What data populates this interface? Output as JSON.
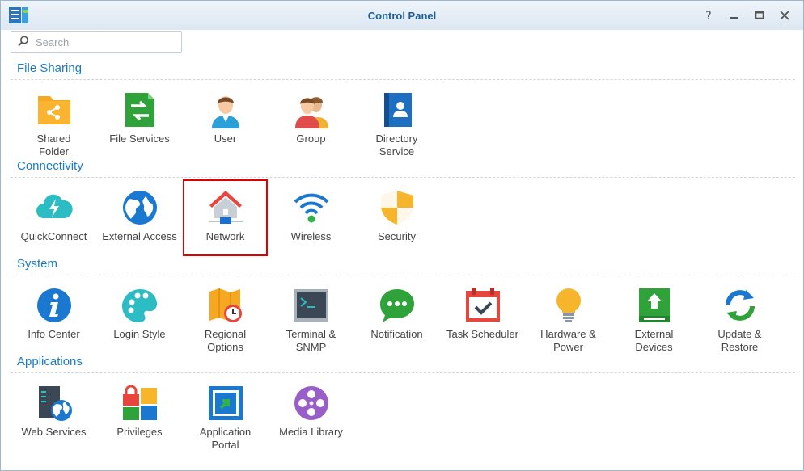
{
  "window": {
    "title": "Control Panel"
  },
  "search": {
    "placeholder": "Search"
  },
  "sections": [
    {
      "title": "File Sharing",
      "items": [
        {
          "label": "Shared\nFolder",
          "icon": "shared-folder-icon"
        },
        {
          "label": "File Services",
          "icon": "file-services-icon"
        },
        {
          "label": "User",
          "icon": "user-icon"
        },
        {
          "label": "Group",
          "icon": "group-icon"
        },
        {
          "label": "Directory\nService",
          "icon": "directory-service-icon"
        }
      ]
    },
    {
      "title": "Connectivity",
      "items": [
        {
          "label": "QuickConnect",
          "icon": "quickconnect-icon"
        },
        {
          "label": "External Access",
          "icon": "external-access-icon"
        },
        {
          "label": "Network",
          "icon": "network-icon",
          "selected": true
        },
        {
          "label": "Wireless",
          "icon": "wireless-icon"
        },
        {
          "label": "Security",
          "icon": "security-icon"
        }
      ]
    },
    {
      "title": "System",
      "items": [
        {
          "label": "Info Center",
          "icon": "info-center-icon"
        },
        {
          "label": "Login Style",
          "icon": "login-style-icon"
        },
        {
          "label": "Regional\nOptions",
          "icon": "regional-options-icon"
        },
        {
          "label": "Terminal &\nSNMP",
          "icon": "terminal-snmp-icon"
        },
        {
          "label": "Notification",
          "icon": "notification-icon"
        },
        {
          "label": "Task Scheduler",
          "icon": "task-scheduler-icon"
        },
        {
          "label": "Hardware &\nPower",
          "icon": "hardware-power-icon"
        },
        {
          "label": "External\nDevices",
          "icon": "external-devices-icon"
        },
        {
          "label": "Update &\nRestore",
          "icon": "update-restore-icon"
        }
      ]
    },
    {
      "title": "Applications",
      "items": [
        {
          "label": "Web Services",
          "icon": "web-services-icon"
        },
        {
          "label": "Privileges",
          "icon": "privileges-icon"
        },
        {
          "label": "Application\nPortal",
          "icon": "application-portal-icon"
        },
        {
          "label": "Media Library",
          "icon": "media-library-icon"
        }
      ]
    }
  ]
}
